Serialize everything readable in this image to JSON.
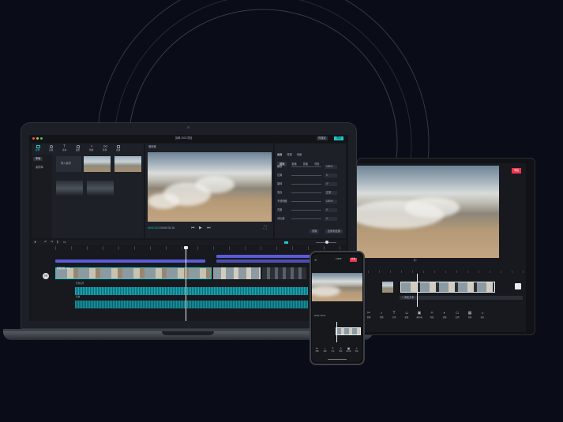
{
  "colors": {
    "background": "#0a0d17",
    "accent_teal": "#1fc7c7",
    "accent_purple": "#5b5bd6",
    "record_red": "#e8364f"
  },
  "laptop": {
    "title_bar": {
      "title": "剪映 2023 项目",
      "export_label": "导出",
      "shortcut_label": "快捷键"
    },
    "media_tabs": [
      "媒体",
      "音频",
      "文本",
      "贴纸",
      "特效",
      "转场",
      "滤镜"
    ],
    "media_sidebar": [
      "本地",
      "素材库"
    ],
    "import_label": "导入素材",
    "player_title": "播放器",
    "timecode": "00:00:13:24",
    "duration": "00:00:31:18",
    "inspector_tabs": [
      "画面",
      "变速",
      "动画"
    ],
    "inspector_subtabs": [
      "基础",
      "抠像",
      "蒙版",
      "背景"
    ],
    "inspector_rows": [
      {
        "label": "缩放",
        "value": "100%"
      },
      {
        "label": "位置",
        "value": "0"
      },
      {
        "label": "旋转",
        "value": "0°"
      },
      {
        "label": "混合",
        "value": "正常"
      },
      {
        "label": "不透明度",
        "value": "100%"
      },
      {
        "label": "亮度",
        "value": "0"
      },
      {
        "label": "对比度",
        "value": "0"
      }
    ],
    "inspector_buttons": [
      "重置",
      "应用到全部"
    ],
    "timeline_labels": {
      "cover": "封面",
      "text_track": "文本",
      "audio_track_1": "背景音乐",
      "audio_track_2": "音效",
      "video_clip": "风景素材.mp4"
    }
  },
  "tablet": {
    "record_label": "导出",
    "text_clip_label": "+ 添加文本",
    "tools": [
      "剪辑",
      "音频",
      "文本",
      "贴纸",
      "画中画",
      "特效",
      "滤镜",
      "比例",
      "背景",
      "调节"
    ]
  },
  "phone": {
    "top_label": "1080P",
    "export_label": "导出",
    "time": "00:05 / 00:31",
    "tools": [
      "剪辑",
      "音频",
      "文本",
      "贴纸",
      "画中画",
      "特效"
    ]
  }
}
